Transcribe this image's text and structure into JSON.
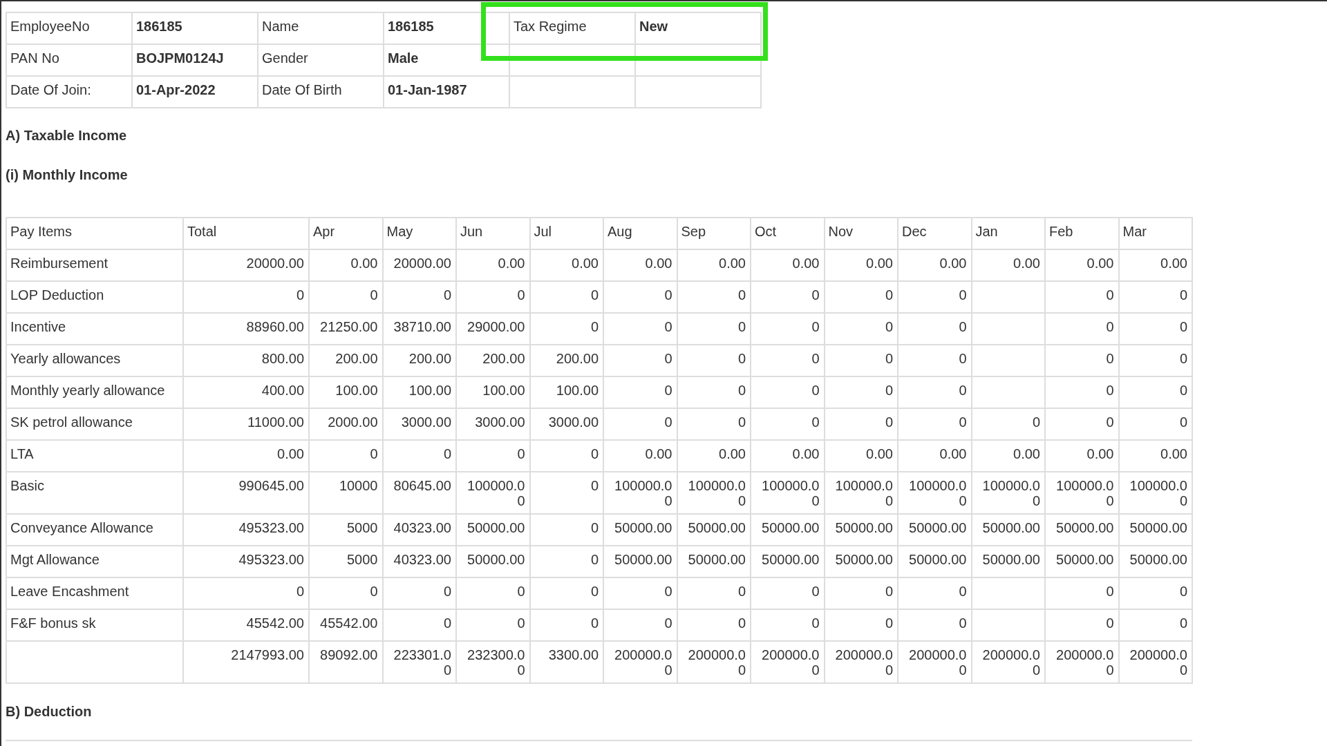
{
  "employee_info": {
    "rows": [
      [
        {
          "label": "EmployeeNo",
          "value": "186185"
        },
        {
          "label": "Name",
          "value": "186185"
        },
        {
          "label": "Tax Regime",
          "value": "New",
          "highlighted": true
        }
      ],
      [
        {
          "label": "PAN No",
          "value": "BOJPM0124J"
        },
        {
          "label": "Gender",
          "value": "Male"
        }
      ],
      [
        {
          "label": "Date Of Join:",
          "value": "01-Apr-2022"
        },
        {
          "label": "Date Of Birth",
          "value": "01-Jan-1987"
        }
      ]
    ]
  },
  "sections": [
    {
      "kind": "heading",
      "text": "A) Taxable Income"
    },
    {
      "kind": "heading",
      "text": "(i) Monthly Income"
    },
    {
      "kind": "table",
      "columns": [
        "Pay Items",
        "Total",
        "Apr",
        "May",
        "Jun",
        "Jul",
        "Aug",
        "Sep",
        "Oct",
        "Nov",
        "Dec",
        "Jan",
        "Feb",
        "Mar"
      ],
      "rows": [
        {
          "item": "Reimbursement",
          "values": [
            "20000.00",
            "0.00",
            "20000.00",
            "0.00",
            "0.00",
            "0.00",
            "0.00",
            "0.00",
            "0.00",
            "0.00",
            "0.00",
            "0.00",
            "0.00"
          ]
        },
        {
          "item": "LOP Deduction",
          "values": [
            "0",
            "0",
            "0",
            "0",
            "0",
            "0",
            "0",
            "0",
            "0",
            "0",
            {
              "empty": true
            },
            "0",
            "0"
          ]
        },
        {
          "item": "Incentive",
          "values": [
            "88960.00",
            "21250.00",
            "38710.00",
            "29000.00",
            "0",
            "0",
            "0",
            "0",
            "0",
            "0",
            {
              "empty": true
            },
            "0",
            "0"
          ]
        },
        {
          "item": "Yearly allowances",
          "values": [
            "800.00",
            "200.00",
            "200.00",
            "200.00",
            "200.00",
            "0",
            "0",
            "0",
            "0",
            "0",
            {
              "empty": true
            },
            "0",
            "0"
          ]
        },
        {
          "item": "Monthly yearly allowance",
          "values": [
            "400.00",
            "100.00",
            "100.00",
            "100.00",
            "100.00",
            "0",
            "0",
            "0",
            "0",
            "0",
            {
              "empty": true
            },
            "0",
            "0"
          ]
        },
        {
          "item": "SK petrol allowance",
          "values": [
            "11000.00",
            "2000.00",
            "3000.00",
            "3000.00",
            "3000.00",
            "0",
            "0",
            "0",
            "0",
            "0",
            "0",
            "0",
            "0"
          ]
        },
        {
          "item": "LTA",
          "values": [
            "0.00",
            "0",
            "0",
            "0",
            "0",
            "0.00",
            "0.00",
            "0.00",
            "0.00",
            "0.00",
            "0.00",
            "0.00",
            "0.00"
          ]
        },
        {
          "item": "Basic",
          "values": [
            "990645.00",
            "10000",
            "80645.00",
            "100000.00",
            "0",
            "100000.00",
            "100000.00",
            "100000.00",
            "100000.00",
            "100000.00",
            "100000.00",
            "100000.00",
            "100000.00"
          ]
        },
        {
          "item": "Conveyance Allowance",
          "values": [
            "495323.00",
            "5000",
            "40323.00",
            "50000.00",
            "0",
            "50000.00",
            "50000.00",
            "50000.00",
            "50000.00",
            "50000.00",
            "50000.00",
            "50000.00",
            "50000.00"
          ]
        },
        {
          "item": "Mgt Allowance",
          "values": [
            "495323.00",
            "5000",
            "40323.00",
            "50000.00",
            "0",
            "50000.00",
            "50000.00",
            "50000.00",
            "50000.00",
            "50000.00",
            "50000.00",
            "50000.00",
            "50000.00"
          ]
        },
        {
          "item": "Leave Encashment",
          "values": [
            "0",
            "0",
            "0",
            "0",
            "0",
            "0",
            "0",
            "0",
            "0",
            "0",
            {
              "empty": true
            },
            "0",
            "0"
          ]
        },
        {
          "item": "F&F bonus sk",
          "values": [
            "45542.00",
            "45542.00",
            "0",
            "0",
            "0",
            "0",
            "0",
            "0",
            "0",
            "0",
            {
              "empty": true
            },
            "0",
            "0"
          ]
        },
        {
          "values": [
            "2147993.00",
            "89092.00",
            "223301.00",
            "232300.00",
            "3300.00",
            "200000.00",
            "200000.00",
            "200000.00",
            "200000.00",
            "200000.00",
            "200000.00",
            "200000.00",
            "200000.00"
          ]
        }
      ]
    },
    {
      "kind": "heading",
      "text": "B) Deduction"
    }
  ]
}
